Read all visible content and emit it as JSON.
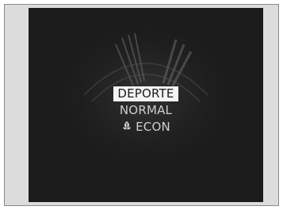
{
  "drive_mode_menu": {
    "items": [
      {
        "label": "DEPORTE",
        "selected": true
      },
      {
        "label": "NORMAL",
        "selected": false
      },
      {
        "label": "ECON",
        "selected": false,
        "icon": "leaf-icon"
      }
    ]
  },
  "colors": {
    "screen_background": "#1b1b1b",
    "frame_background": "#dcdcdc",
    "highlight": "#f4f4f4",
    "text": "#cfcfcf"
  }
}
